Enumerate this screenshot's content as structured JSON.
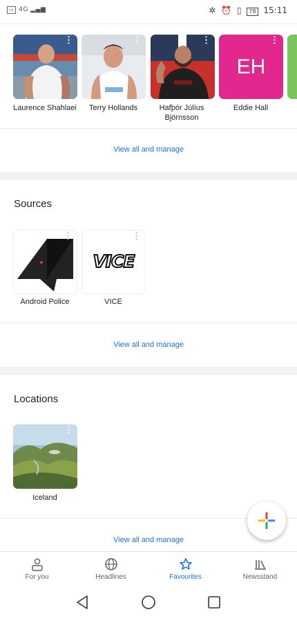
{
  "status_bar": {
    "left": "4G",
    "battery": "78",
    "time": "15:11"
  },
  "people": [
    {
      "name": "Laurence Shahlaei"
    },
    {
      "name": "Terry Hollands"
    },
    {
      "name": "Hafþór Júlíus Björnsson"
    },
    {
      "name": "Eddie Hall",
      "initials": "EH"
    }
  ],
  "people_view_all": "View all and manage",
  "sources": {
    "title": "Sources",
    "items": [
      {
        "name": "Android Police"
      },
      {
        "name": "VICE",
        "logo_text": "VICE"
      }
    ],
    "view_all": "View all and manage"
  },
  "locations": {
    "title": "Locations",
    "items": [
      {
        "name": "Iceland"
      }
    ],
    "view_all": "View all and manage"
  },
  "bottom_nav": [
    {
      "label": "For you",
      "icon": "person-icon"
    },
    {
      "label": "Headlines",
      "icon": "globe-icon"
    },
    {
      "label": "Favourites",
      "icon": "star-icon",
      "active": true
    },
    {
      "label": "Newsstand",
      "icon": "newsstand-icon"
    }
  ],
  "colors": {
    "accent": "#1a73e8",
    "eddie_bg": "#e2288e",
    "divider": "#f1f3f4"
  }
}
